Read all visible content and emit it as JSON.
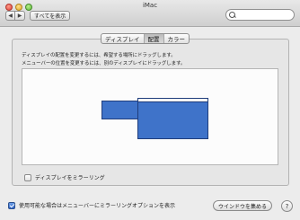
{
  "window": {
    "title": "iMac"
  },
  "toolbar": {
    "back_glyph": "◀",
    "forward_glyph": "▶",
    "show_all_label": "すべてを表示",
    "search": {
      "placeholder": "",
      "value": ""
    }
  },
  "tabs": [
    {
      "label": "ディスプレイ",
      "active": false
    },
    {
      "label": "配置",
      "active": true
    },
    {
      "label": "カラー",
      "active": false
    }
  ],
  "arrangement": {
    "instruction_line1": "ディスプレイの配置を変更するには、希望する場所にドラッグします。",
    "instruction_line2": "メニューバーの位置を変更するには、別のディスプレイにドラッグします。"
  },
  "mirror": {
    "label": "ディスプレイをミラーリング",
    "checked": false
  },
  "menu_option": {
    "label": "使用可能な場合はメニューバーにミラーリングオプションを表示",
    "checked": true
  },
  "gather_windows_label": "ウインドウを集める",
  "help_label": "?",
  "colors": {
    "display_blue": "#3f73c9",
    "window_bg": "#ececec"
  }
}
